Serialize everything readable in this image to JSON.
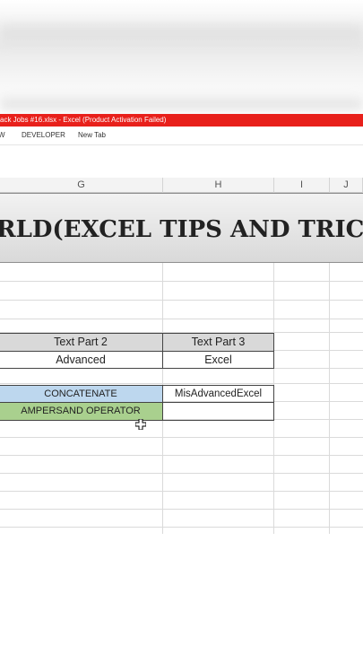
{
  "window": {
    "title": "ack Jobs #16.xlsx -  Excel (Product Activation Failed)"
  },
  "ribbon": {
    "tabs": [
      "W",
      "DEVELOPER",
      "New Tab"
    ]
  },
  "columns": [
    "G",
    "H",
    "I",
    "J"
  ],
  "banner": {
    "text": "RLD(EXCEL TIPS AND TRICKS )"
  },
  "table": {
    "headers": [
      "Text Part 2",
      "Text Part 3"
    ],
    "values": [
      "Advanced",
      "Excel"
    ]
  },
  "formulas": {
    "concatenate_label": "CONCATENATE",
    "concatenate_result": "MisAdvancedExcel",
    "ampersand_label": "AMPERSAND OPERATOR",
    "ampersand_result": ""
  },
  "colors": {
    "titlebar": "#e8201b",
    "concatenate_fill": "#bdd7ee",
    "ampersand_fill": "#a9d08e",
    "header_fill": "#d9d9d9"
  },
  "icons": {
    "cursor": "excel-cross-cursor-icon"
  }
}
